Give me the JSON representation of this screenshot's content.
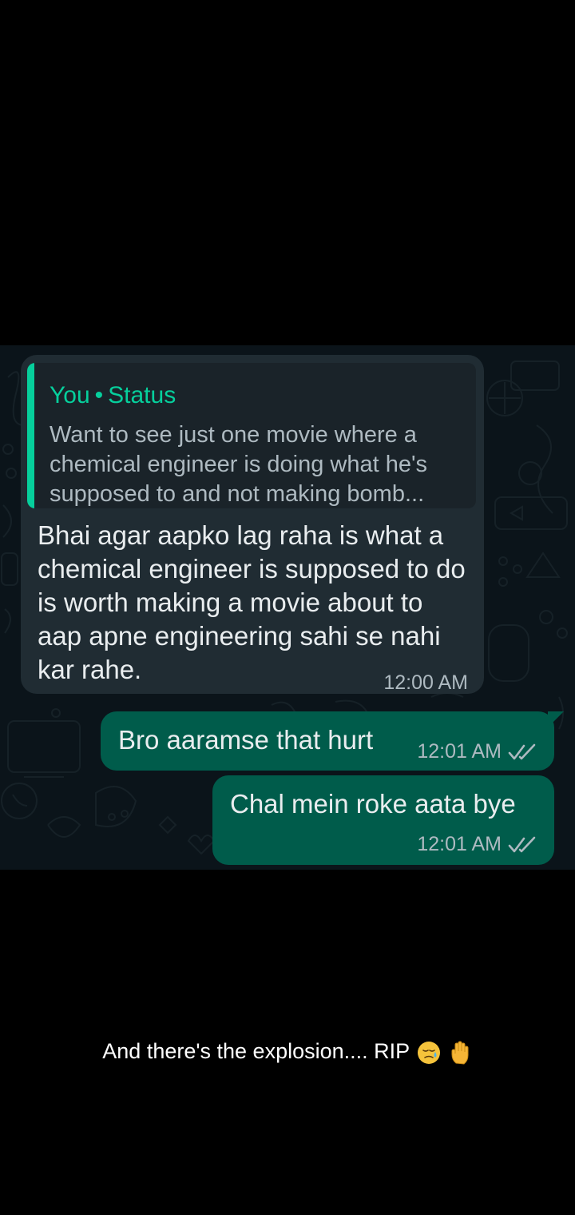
{
  "chat": {
    "incoming": {
      "reply_header_sender": "You",
      "reply_header_separator": "•",
      "reply_header_type": "Status",
      "quoted_text": "Want to see just one movie where a chemical engineer is doing what he's supposed to and not making bomb...",
      "text": "Bhai agar aapko lag raha is what a chemical engineer is supposed to do is worth making a movie about to aap apne engineering sahi se nahi kar rahe.",
      "time": "12:00 AM"
    },
    "outgoing": [
      {
        "text": "Bro aaramse that hurt",
        "time": "12:01 AM",
        "status_icon": "double-check-icon"
      },
      {
        "text": "Chal mein roke aata bye",
        "time": "12:01 AM",
        "status_icon": "double-check-icon"
      }
    ]
  },
  "caption": {
    "text": "And there's the explosion.... RIP",
    "emojis": [
      "sad-relieved-face-emoji",
      "raised-hand-emoji"
    ]
  },
  "colors": {
    "background": "#000000",
    "chat_background": "#0b141a",
    "incoming_bubble": "#202c33",
    "outgoing_bubble": "#005c4b",
    "accent": "#06cf9c",
    "message_text": "#e9edef",
    "meta_text": "#aebac1"
  }
}
